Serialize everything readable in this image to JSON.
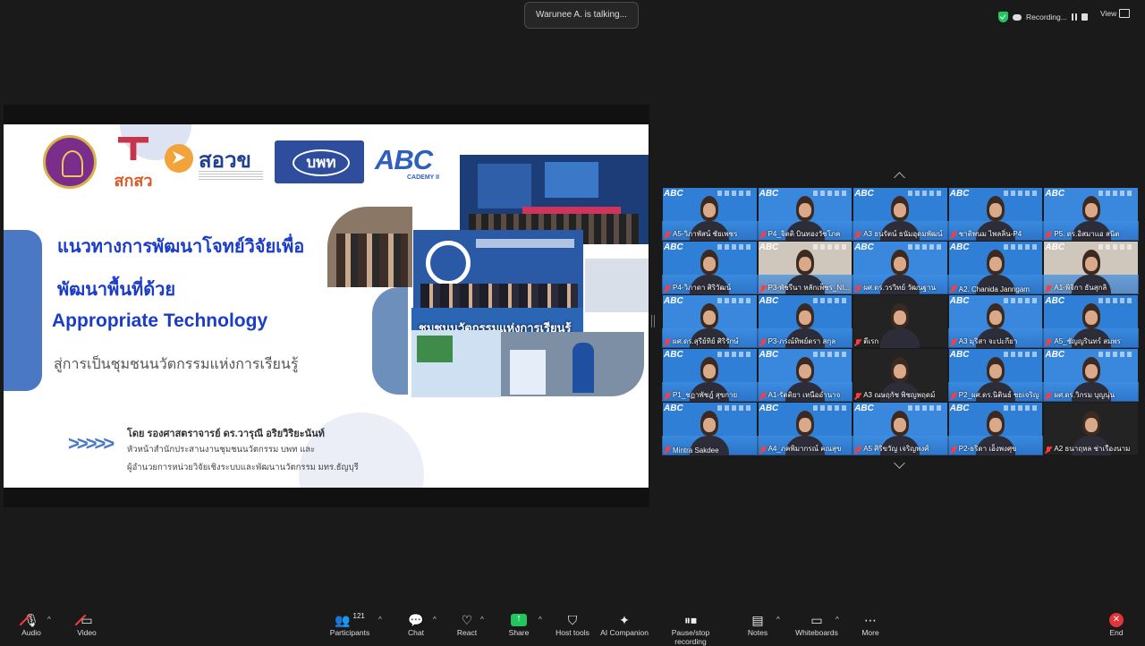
{
  "top": {
    "talking": "Warunee A. is talking...",
    "recording": "Recording...",
    "view": "View"
  },
  "slide": {
    "logos": {
      "tsri": "สกสว",
      "sorwor": "สอวข",
      "bpn": "บพท",
      "abc": "ABC",
      "abc_sub": "CADEMY II"
    },
    "title_line1": "แนวทางการพัฒนาโจทย์วิจัยเพื่อ",
    "title_line2": "พัฒนาพื้นที่ด้วย",
    "title_line3": "Appropriate Technology",
    "title_line4": "สู่การเป็นชุมชนนวัตกรรมแห่งการเรียนรู้",
    "chevrons": ">>>>>",
    "author": "โดย รองศาสตราจารย์ ดร.วารุณี  อริยวิริยะนันท์",
    "position1": "หัวหน้าสำนักประสานงานชุมชนนวัตกรรม บพท และ",
    "position2": "ผู้อำนวยการหน่วยวิจัยเชิงระบบและพัฒนานวัตกรรม มทร.ธัญบุรี",
    "collage_caption": "ชุมชนนวัตกรรมแห่งการเรียนรู้"
  },
  "gallery": {
    "participants": [
      {
        "name": "A5-วิภาพัสน์ ชัยเพชร",
        "type": "person"
      },
      {
        "name": "P4_จิตติ บินทองวัชโภค",
        "type": "person"
      },
      {
        "name": "A3 ธนรัตน์ ธนัมอุดมพัฒน์",
        "type": "person"
      },
      {
        "name": "ชาติพนม ไพลลิ่น-P4",
        "type": "person"
      },
      {
        "name": "P5. ดร.อิสมาแอ สนิต",
        "type": "person"
      },
      {
        "name": "P4-วิภาดา ศิริวัฒน์",
        "type": "person"
      },
      {
        "name": "P3-พัชรีนา หลักเพ็ชร_NI...",
        "type": "room"
      },
      {
        "name": "ผศ.ดร.วรวิทย์ วัฒนฐาน",
        "type": "person"
      },
      {
        "name": "A2. Chanida Janngam",
        "type": "person"
      },
      {
        "name": "A1-พิจิกา ธันสุกลิ",
        "type": "room"
      },
      {
        "name": "ผศ.ดร.สุรีย์ทิย์ ศิริรักษ์",
        "type": "person"
      },
      {
        "name": "P3-ภรณ์ทิพย์ตรา สกุล",
        "type": "person"
      },
      {
        "name": "ตีเรก",
        "type": "dark"
      },
      {
        "name": "A3 มุริสา จะปะกียา",
        "type": "person"
      },
      {
        "name": "A5_ชัญญรินทร์ สมพร",
        "type": "person"
      },
      {
        "name": "P1_ชฏาพัชฎ์ สุขกาย",
        "type": "person"
      },
      {
        "name": "A1-รัตติยา เหนืออำนาจ",
        "type": "person"
      },
      {
        "name": "A3 ณษฤกัช พิชญพฤดม์",
        "type": "dark"
      },
      {
        "name": "P2_ผศ.ดร.นิตินธ์ ชยเจริญ",
        "type": "person"
      },
      {
        "name": "ผศ.ดร.วิกรม บุญนุ่น",
        "type": "person"
      },
      {
        "name": "Mintra Sakdee",
        "type": "person"
      },
      {
        "name": "A4_ภคพิมากรณ์ คณสุข",
        "type": "person"
      },
      {
        "name": "A5 ศิริขวัญ เจริญพงศ์",
        "type": "person"
      },
      {
        "name": "P2-ธริดา เอ็งพงศุข",
        "type": "person"
      },
      {
        "name": "A2 ธนาฤหล ช่าเรืองนาม",
        "type": "dark"
      }
    ]
  },
  "toolbar": {
    "audio": "Audio",
    "video": "Video",
    "participants_count": "121",
    "participants": "Participants",
    "chat": "Chat",
    "react": "React",
    "share": "Share",
    "host_tools": "Host tools",
    "ai_companion": "AI Companion",
    "pause_recording": "Pause/stop recording",
    "notes": "Notes",
    "whiteboards": "Whiteboards",
    "more": "More",
    "end": "End"
  },
  "colors": {
    "accent_green": "#22c55e",
    "end_red": "#e5333a",
    "slide_title": "#1b3cc7",
    "tile_blue": "#2f7fd6"
  }
}
